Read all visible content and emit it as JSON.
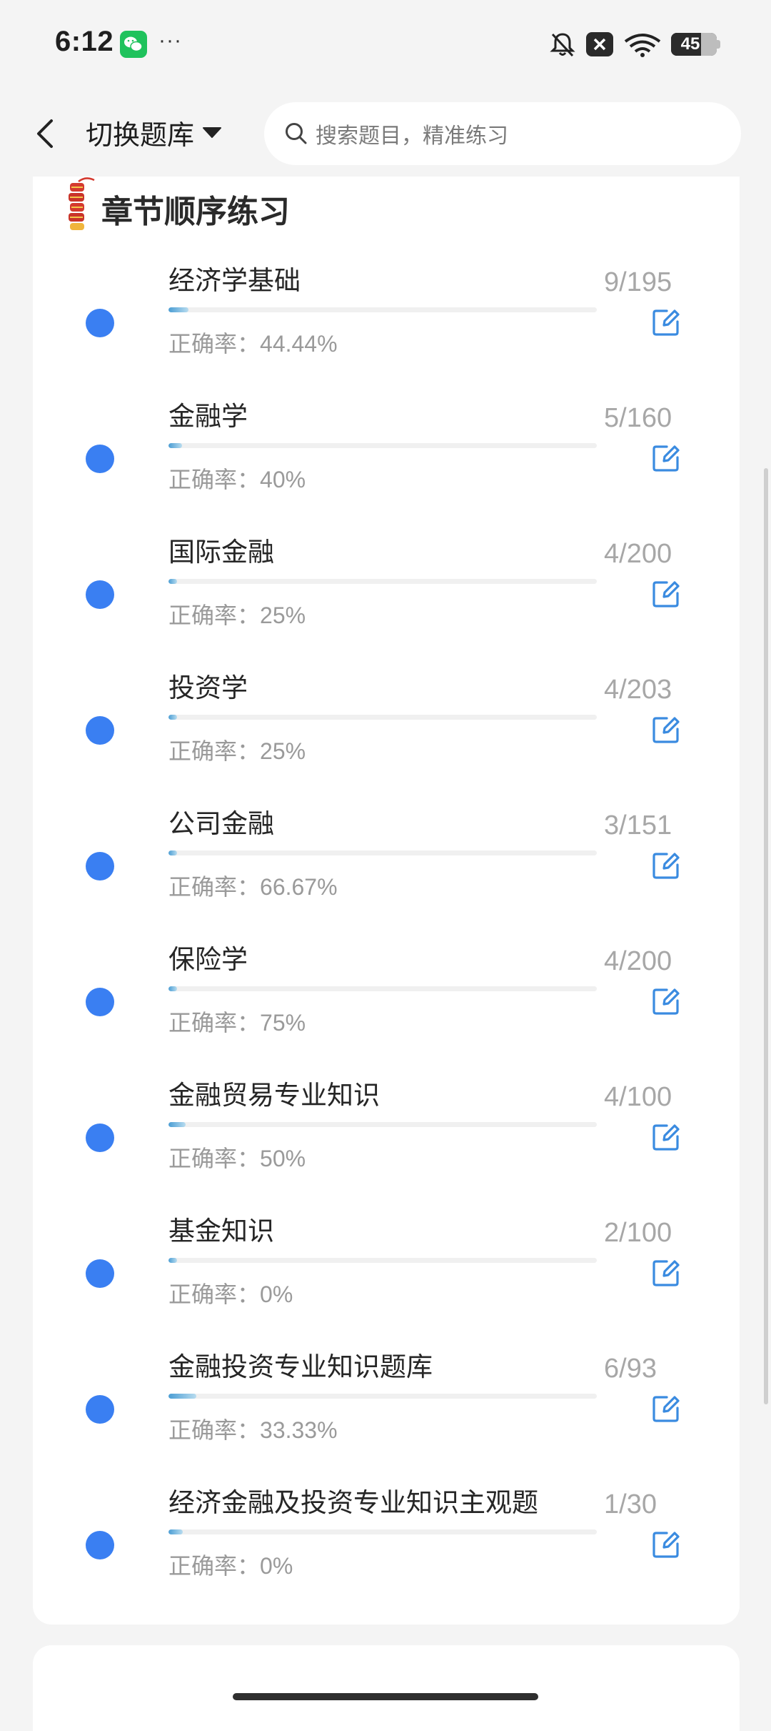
{
  "status_bar": {
    "time": "6:12",
    "more": "···",
    "battery": "45"
  },
  "header": {
    "switch_label": "切换题库",
    "search_placeholder": "搜索题目，精准练习"
  },
  "section": {
    "title": "章节顺序练习",
    "accuracy_prefix": "正确率：",
    "chapters": [
      {
        "name": "经济学基础",
        "accuracy": "44.44%",
        "done": 9,
        "total": 195,
        "count": "9/195",
        "progress": 0.046
      },
      {
        "name": "金融学",
        "accuracy": "40%",
        "done": 5,
        "total": 160,
        "count": "5/160",
        "progress": 0.031
      },
      {
        "name": "国际金融",
        "accuracy": "25%",
        "done": 4,
        "total": 200,
        "count": "4/200",
        "progress": 0.02
      },
      {
        "name": "投资学",
        "accuracy": "25%",
        "done": 4,
        "total": 203,
        "count": "4/203",
        "progress": 0.02
      },
      {
        "name": "公司金融",
        "accuracy": "66.67%",
        "done": 3,
        "total": 151,
        "count": "3/151",
        "progress": 0.02
      },
      {
        "name": "保险学",
        "accuracy": "75%",
        "done": 4,
        "total": 200,
        "count": "4/200",
        "progress": 0.02
      },
      {
        "name": "金融贸易专业知识",
        "accuracy": "50%",
        "done": 4,
        "total": 100,
        "count": "4/100",
        "progress": 0.04
      },
      {
        "name": "基金知识",
        "accuracy": "0%",
        "done": 2,
        "total": 100,
        "count": "2/100",
        "progress": 0.02
      },
      {
        "name": "金融投资专业知识题库",
        "accuracy": "33.33%",
        "done": 6,
        "total": 93,
        "count": "6/93",
        "progress": 0.065
      },
      {
        "name": "经济金融及投资专业知识主观题",
        "accuracy": "0%",
        "done": 1,
        "total": 30,
        "count": "1/30",
        "progress": 0.033
      }
    ]
  },
  "colors": {
    "accent": "#3a7ff2",
    "muted_text": "#9a9a9a",
    "count_text": "#a7a7a7",
    "edit_icon": "#3a8be0"
  }
}
